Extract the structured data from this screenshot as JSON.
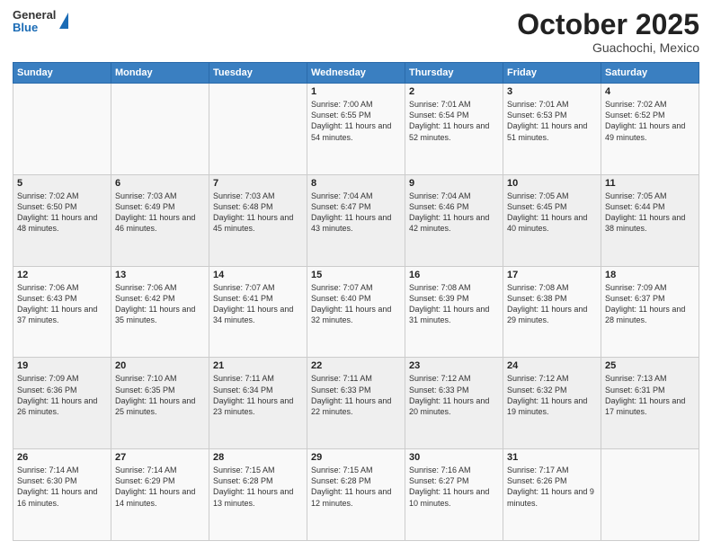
{
  "header": {
    "logo_line1": "General",
    "logo_line2": "Blue",
    "month": "October 2025",
    "location": "Guachochi, Mexico"
  },
  "weekdays": [
    "Sunday",
    "Monday",
    "Tuesday",
    "Wednesday",
    "Thursday",
    "Friday",
    "Saturday"
  ],
  "rows": [
    [
      {
        "day": "",
        "info": ""
      },
      {
        "day": "",
        "info": ""
      },
      {
        "day": "",
        "info": ""
      },
      {
        "day": "1",
        "info": "Sunrise: 7:00 AM\nSunset: 6:55 PM\nDaylight: 11 hours\nand 54 minutes."
      },
      {
        "day": "2",
        "info": "Sunrise: 7:01 AM\nSunset: 6:54 PM\nDaylight: 11 hours\nand 52 minutes."
      },
      {
        "day": "3",
        "info": "Sunrise: 7:01 AM\nSunset: 6:53 PM\nDaylight: 11 hours\nand 51 minutes."
      },
      {
        "day": "4",
        "info": "Sunrise: 7:02 AM\nSunset: 6:52 PM\nDaylight: 11 hours\nand 49 minutes."
      }
    ],
    [
      {
        "day": "5",
        "info": "Sunrise: 7:02 AM\nSunset: 6:50 PM\nDaylight: 11 hours\nand 48 minutes."
      },
      {
        "day": "6",
        "info": "Sunrise: 7:03 AM\nSunset: 6:49 PM\nDaylight: 11 hours\nand 46 minutes."
      },
      {
        "day": "7",
        "info": "Sunrise: 7:03 AM\nSunset: 6:48 PM\nDaylight: 11 hours\nand 45 minutes."
      },
      {
        "day": "8",
        "info": "Sunrise: 7:04 AM\nSunset: 6:47 PM\nDaylight: 11 hours\nand 43 minutes."
      },
      {
        "day": "9",
        "info": "Sunrise: 7:04 AM\nSunset: 6:46 PM\nDaylight: 11 hours\nand 42 minutes."
      },
      {
        "day": "10",
        "info": "Sunrise: 7:05 AM\nSunset: 6:45 PM\nDaylight: 11 hours\nand 40 minutes."
      },
      {
        "day": "11",
        "info": "Sunrise: 7:05 AM\nSunset: 6:44 PM\nDaylight: 11 hours\nand 38 minutes."
      }
    ],
    [
      {
        "day": "12",
        "info": "Sunrise: 7:06 AM\nSunset: 6:43 PM\nDaylight: 11 hours\nand 37 minutes."
      },
      {
        "day": "13",
        "info": "Sunrise: 7:06 AM\nSunset: 6:42 PM\nDaylight: 11 hours\nand 35 minutes."
      },
      {
        "day": "14",
        "info": "Sunrise: 7:07 AM\nSunset: 6:41 PM\nDaylight: 11 hours\nand 34 minutes."
      },
      {
        "day": "15",
        "info": "Sunrise: 7:07 AM\nSunset: 6:40 PM\nDaylight: 11 hours\nand 32 minutes."
      },
      {
        "day": "16",
        "info": "Sunrise: 7:08 AM\nSunset: 6:39 PM\nDaylight: 11 hours\nand 31 minutes."
      },
      {
        "day": "17",
        "info": "Sunrise: 7:08 AM\nSunset: 6:38 PM\nDaylight: 11 hours\nand 29 minutes."
      },
      {
        "day": "18",
        "info": "Sunrise: 7:09 AM\nSunset: 6:37 PM\nDaylight: 11 hours\nand 28 minutes."
      }
    ],
    [
      {
        "day": "19",
        "info": "Sunrise: 7:09 AM\nSunset: 6:36 PM\nDaylight: 11 hours\nand 26 minutes."
      },
      {
        "day": "20",
        "info": "Sunrise: 7:10 AM\nSunset: 6:35 PM\nDaylight: 11 hours\nand 25 minutes."
      },
      {
        "day": "21",
        "info": "Sunrise: 7:11 AM\nSunset: 6:34 PM\nDaylight: 11 hours\nand 23 minutes."
      },
      {
        "day": "22",
        "info": "Sunrise: 7:11 AM\nSunset: 6:33 PM\nDaylight: 11 hours\nand 22 minutes."
      },
      {
        "day": "23",
        "info": "Sunrise: 7:12 AM\nSunset: 6:33 PM\nDaylight: 11 hours\nand 20 minutes."
      },
      {
        "day": "24",
        "info": "Sunrise: 7:12 AM\nSunset: 6:32 PM\nDaylight: 11 hours\nand 19 minutes."
      },
      {
        "day": "25",
        "info": "Sunrise: 7:13 AM\nSunset: 6:31 PM\nDaylight: 11 hours\nand 17 minutes."
      }
    ],
    [
      {
        "day": "26",
        "info": "Sunrise: 7:14 AM\nSunset: 6:30 PM\nDaylight: 11 hours\nand 16 minutes."
      },
      {
        "day": "27",
        "info": "Sunrise: 7:14 AM\nSunset: 6:29 PM\nDaylight: 11 hours\nand 14 minutes."
      },
      {
        "day": "28",
        "info": "Sunrise: 7:15 AM\nSunset: 6:28 PM\nDaylight: 11 hours\nand 13 minutes."
      },
      {
        "day": "29",
        "info": "Sunrise: 7:15 AM\nSunset: 6:28 PM\nDaylight: 11 hours\nand 12 minutes."
      },
      {
        "day": "30",
        "info": "Sunrise: 7:16 AM\nSunset: 6:27 PM\nDaylight: 11 hours\nand 10 minutes."
      },
      {
        "day": "31",
        "info": "Sunrise: 7:17 AM\nSunset: 6:26 PM\nDaylight: 11 hours\nand 9 minutes."
      },
      {
        "day": "",
        "info": ""
      }
    ]
  ]
}
